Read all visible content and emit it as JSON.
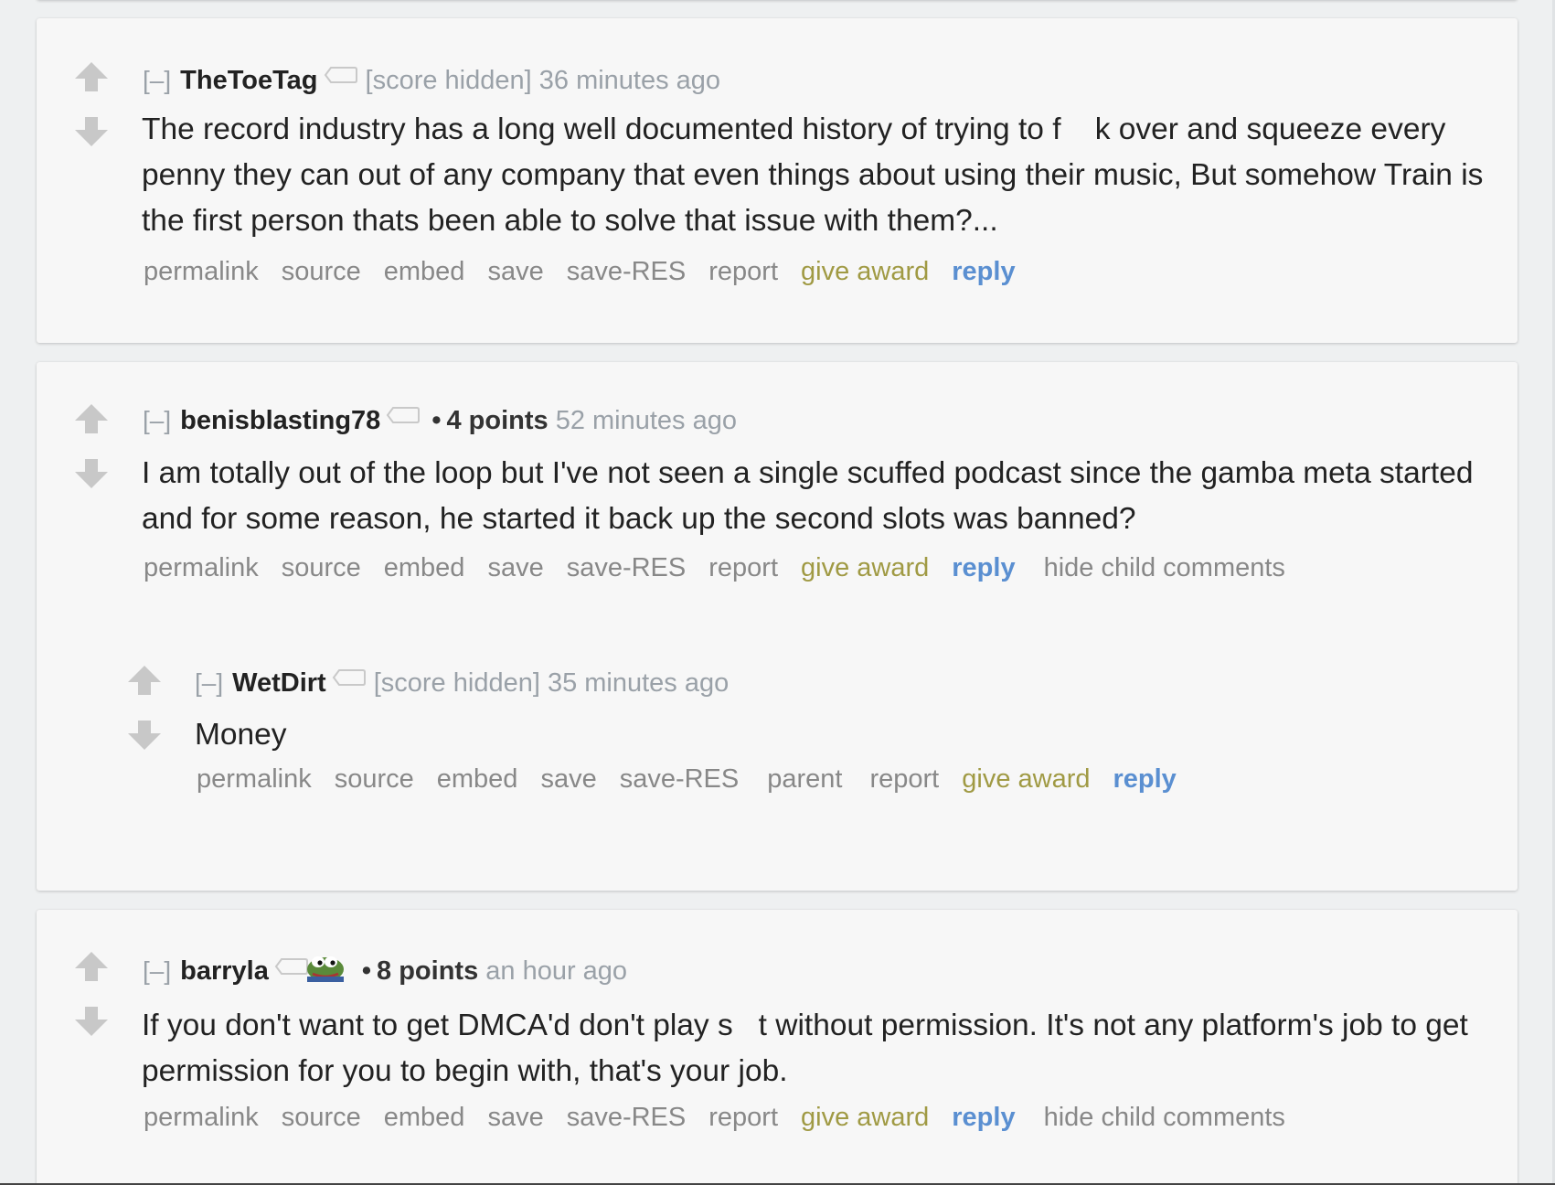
{
  "comments": [
    {
      "collapse": "[–]",
      "author": "TheToeTag",
      "score": "[score hidden]",
      "time": "36 minutes ago",
      "body": "The record industry has a long well documented history of trying to f    k over and squeeze every penny they can out of any company that even things about using their music, But somehow Train is the first person thats been able to solve that issue with them?...",
      "actions": [
        "permalink",
        "source",
        "embed",
        "save",
        "save-RES",
        "report",
        "give award",
        "reply"
      ]
    },
    {
      "collapse": "[–]",
      "author": "benisblasting78",
      "bullet": "•",
      "score": "4 points",
      "time": "52 minutes ago",
      "body": "I am totally out of the loop but I've not seen a single scuffed podcast since the gamba meta started and for some reason, he started it back up the second slots was banned?",
      "actions": [
        "permalink",
        "source",
        "embed",
        "save",
        "save-RES",
        "report",
        "give award",
        "reply",
        "hide child comments"
      ]
    },
    {
      "collapse": "[–]",
      "author": "WetDirt",
      "score": "[score hidden]",
      "time": "35 minutes ago",
      "body": "Money",
      "actions": [
        "permalink",
        "source",
        "embed",
        "save",
        "save-RES",
        "parent",
        "report",
        "give award",
        "reply"
      ]
    },
    {
      "collapse": "[–]",
      "author": "barryla",
      "flair_icon": "pepe-frog-flair-icon",
      "bullet": "•",
      "score": "8 points",
      "time": "an hour ago",
      "body": "If you don't want to get DMCA'd don't play s   t without permission. It's not any platform's job to get permission for you to begin with, that's your job.",
      "actions": [
        "permalink",
        "source",
        "embed",
        "save",
        "save-RES",
        "report",
        "give award",
        "reply",
        "hide child comments"
      ]
    }
  ],
  "icons": {
    "upvote": "upvote-arrow-icon",
    "downvote": "downvote-arrow-icon",
    "user_tag": "user-tag-icon"
  },
  "colors": {
    "award": "#a09a44",
    "reply": "#5a8fd1",
    "muted": "#9aa1a8",
    "action": "#888888"
  }
}
